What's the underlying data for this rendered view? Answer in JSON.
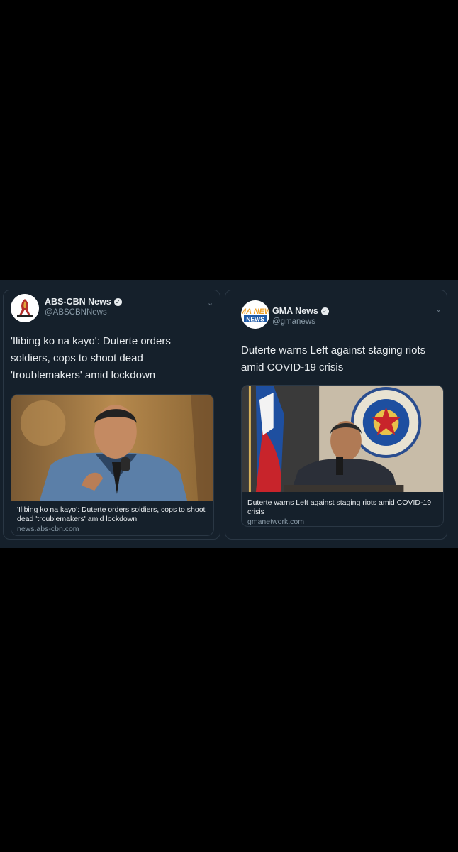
{
  "tweets": [
    {
      "account_name": "ABS-CBN News",
      "handle": "@ABSCBNNews",
      "text": "'Ilibing ko na kayo': Duterte orders soldiers, cops to shoot dead 'troublemakers' amid lockdown",
      "card": {
        "title": "'Ilibing ko na kayo': Duterte orders soldiers, cops to shoot dead 'troublemakers' amid lockdown",
        "domain": "news.abs-cbn.com"
      },
      "avatar_icon": "abs-cbn-logo-icon"
    },
    {
      "account_name": "GMA News",
      "handle": "@gmanews",
      "text": "Duterte warns Left against staging riots amid COVID-19 crisis",
      "card": {
        "title": "Duterte warns Left against staging riots amid COVID-19 crisis",
        "domain": "gmanetwork.com"
      },
      "avatar_icon": "gma-news-logo-icon",
      "avatar_logo_text": "GMA NEWS"
    }
  ],
  "colors": {
    "background": "#000000",
    "tweet_bg": "#15202b",
    "border": "#2a3744",
    "text": "#e8ecef",
    "muted": "#8899a6"
  }
}
